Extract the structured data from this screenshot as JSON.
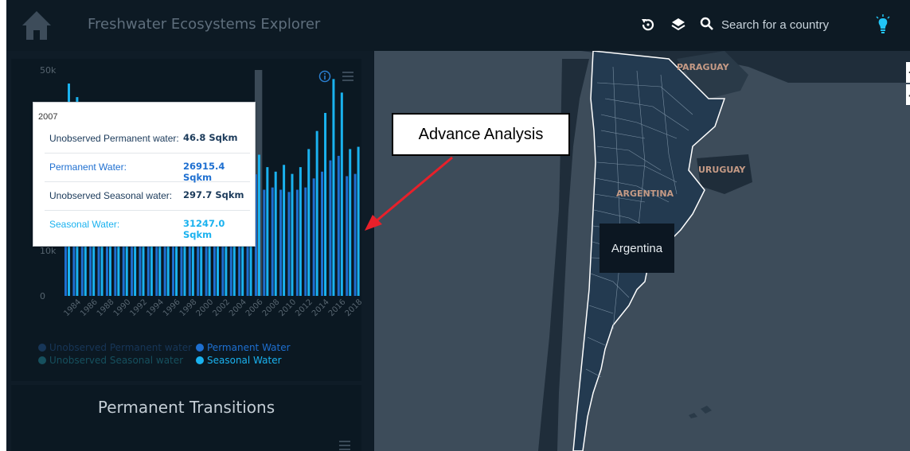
{
  "header": {
    "title": "Freshwater Ecosystems Explorer",
    "search_placeholder": "Search for a country",
    "icons": [
      "home-icon",
      "history-icon",
      "layers-icon",
      "search-icon",
      "lightbulb-icon"
    ]
  },
  "chart": {
    "y_ticks": [
      "50k",
      "10k",
      "0"
    ],
    "x_tick_labels": [
      "1984",
      "1986",
      "1988",
      "1990",
      "1992",
      "1994",
      "1996",
      "1998",
      "2000",
      "2002",
      "2004",
      "2006",
      "2008",
      "2010",
      "2012",
      "2014",
      "2016",
      "2018"
    ],
    "legend": {
      "unobserved_permanent": "Unobserved Permanent water",
      "permanent": "Permanent Water",
      "unobserved_seasonal": "Unobserved Seasonal water",
      "seasonal": "Seasonal Water"
    },
    "colors": {
      "permanent": "#1e6fd0",
      "seasonal": "#1ab2ef",
      "unobserved_permanent": "#15375e",
      "unobserved_seasonal": "#16505e"
    },
    "highlighted_year": "2007"
  },
  "chart_data": {
    "type": "bar",
    "categories": [
      "1984",
      "1985",
      "1986",
      "1987",
      "1988",
      "1989",
      "1990",
      "1991",
      "1992",
      "1993",
      "1994",
      "1995",
      "1996",
      "1997",
      "1998",
      "1999",
      "2000",
      "2001",
      "2002",
      "2003",
      "2004",
      "2005",
      "2006",
      "2007",
      "2008",
      "2009",
      "2010",
      "2011",
      "2012",
      "2013",
      "2014",
      "2015",
      "2016",
      "2017",
      "2018",
      "2019"
    ],
    "series": [
      {
        "name": "Permanent Water",
        "values": [
          23000,
          24000,
          24000,
          24000,
          24000,
          24000,
          24000,
          24000,
          24000,
          24000,
          24000,
          24000,
          24000,
          24000,
          24000,
          24000,
          24000,
          24000,
          24000,
          24000,
          24000,
          24000,
          24000,
          26915,
          23500,
          24000,
          23500,
          23000,
          23500,
          24000,
          26000,
          27500,
          30000,
          31000,
          26500,
          27000
        ]
      },
      {
        "name": "Seasonal Water",
        "values": [
          47000,
          44000,
          30000,
          30000,
          30000,
          30000,
          30000,
          30000,
          30000,
          30000,
          30000,
          30000,
          30000,
          30000,
          30000,
          30000,
          30000,
          30000,
          30000,
          30000,
          30000,
          30000,
          30000,
          31247,
          28500,
          27500,
          29000,
          27000,
          28500,
          32500,
          36500,
          40500,
          48000,
          45000,
          32500,
          33000
        ]
      }
    ],
    "ylim": [
      0,
      50000
    ]
  },
  "tooltip": {
    "year": "2007",
    "rows": [
      {
        "label": "Unobserved Permanent water:",
        "value": "46.8 Sqkm"
      },
      {
        "label": "Permanent Water:",
        "value": "26915.4 Sqkm"
      },
      {
        "label": "Unobserved Seasonal water:",
        "value": "297.7 Sqkm"
      },
      {
        "label": "Seasonal Water:",
        "value": "31247.0 Sqkm"
      }
    ]
  },
  "transitions": {
    "title": "Permanent Transitions"
  },
  "map": {
    "labels": {
      "paraguay": "PARAGUAY",
      "uruguay": "URUGUAY",
      "argentina": "ARGENTINA"
    },
    "hover_country": "Argentina",
    "zoom_in": "+",
    "zoom_out": "-"
  },
  "annotation": {
    "text": "Advance Analysis",
    "color": "#e8202a"
  }
}
